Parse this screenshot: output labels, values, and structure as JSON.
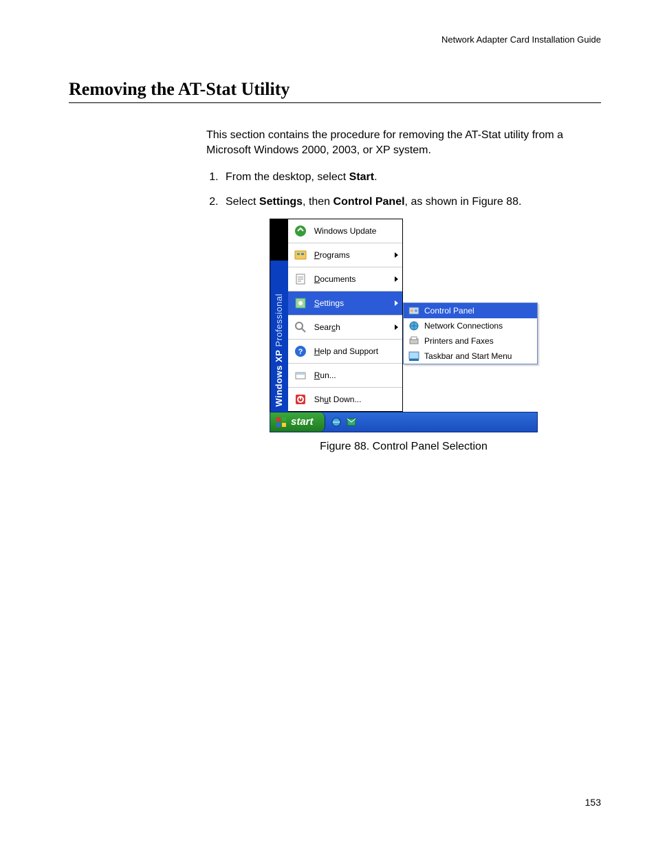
{
  "header": {
    "running": "Network Adapter Card Installation Guide"
  },
  "title": "Removing the AT-Stat Utility",
  "intro": "This section contains the procedure for removing the AT-Stat utility from a Microsoft Windows 2000, 2003, or XP system.",
  "steps": {
    "s1_pre": "From the desktop, select ",
    "s1_bold": "Start",
    "s1_post": ".",
    "s2_pre": "Select ",
    "s2_b1": "Settings",
    "s2_mid": ", then ",
    "s2_b2": "Control Panel",
    "s2_post": ", as shown in Figure 88."
  },
  "figure_caption": "Figure 88. Control Panel Selection",
  "page_number": "153",
  "startmenu": {
    "brand_main": "Windows XP",
    "brand_sub": "Professional",
    "items": [
      {
        "label": "Windows Update",
        "arrow": false
      },
      {
        "label": "Programs",
        "arrow": true,
        "u": "P"
      },
      {
        "label": "Documents",
        "arrow": true,
        "u": "D"
      },
      {
        "label": "Settings",
        "arrow": true,
        "u": "S",
        "highlight": true
      },
      {
        "label": "Search",
        "arrow": true,
        "uAt": 4
      },
      {
        "label": "Help and Support",
        "arrow": false,
        "u": "H"
      },
      {
        "label": "Run...",
        "arrow": false,
        "u": "R"
      },
      {
        "label": "Shut Down...",
        "arrow": false,
        "uAt": 3
      }
    ],
    "submenu": [
      {
        "label": "Control Panel",
        "highlight": true
      },
      {
        "label": "Network Connections"
      },
      {
        "label": "Printers and Faxes"
      },
      {
        "label": "Taskbar and Start Menu"
      }
    ],
    "taskbar": {
      "start": "start"
    }
  }
}
